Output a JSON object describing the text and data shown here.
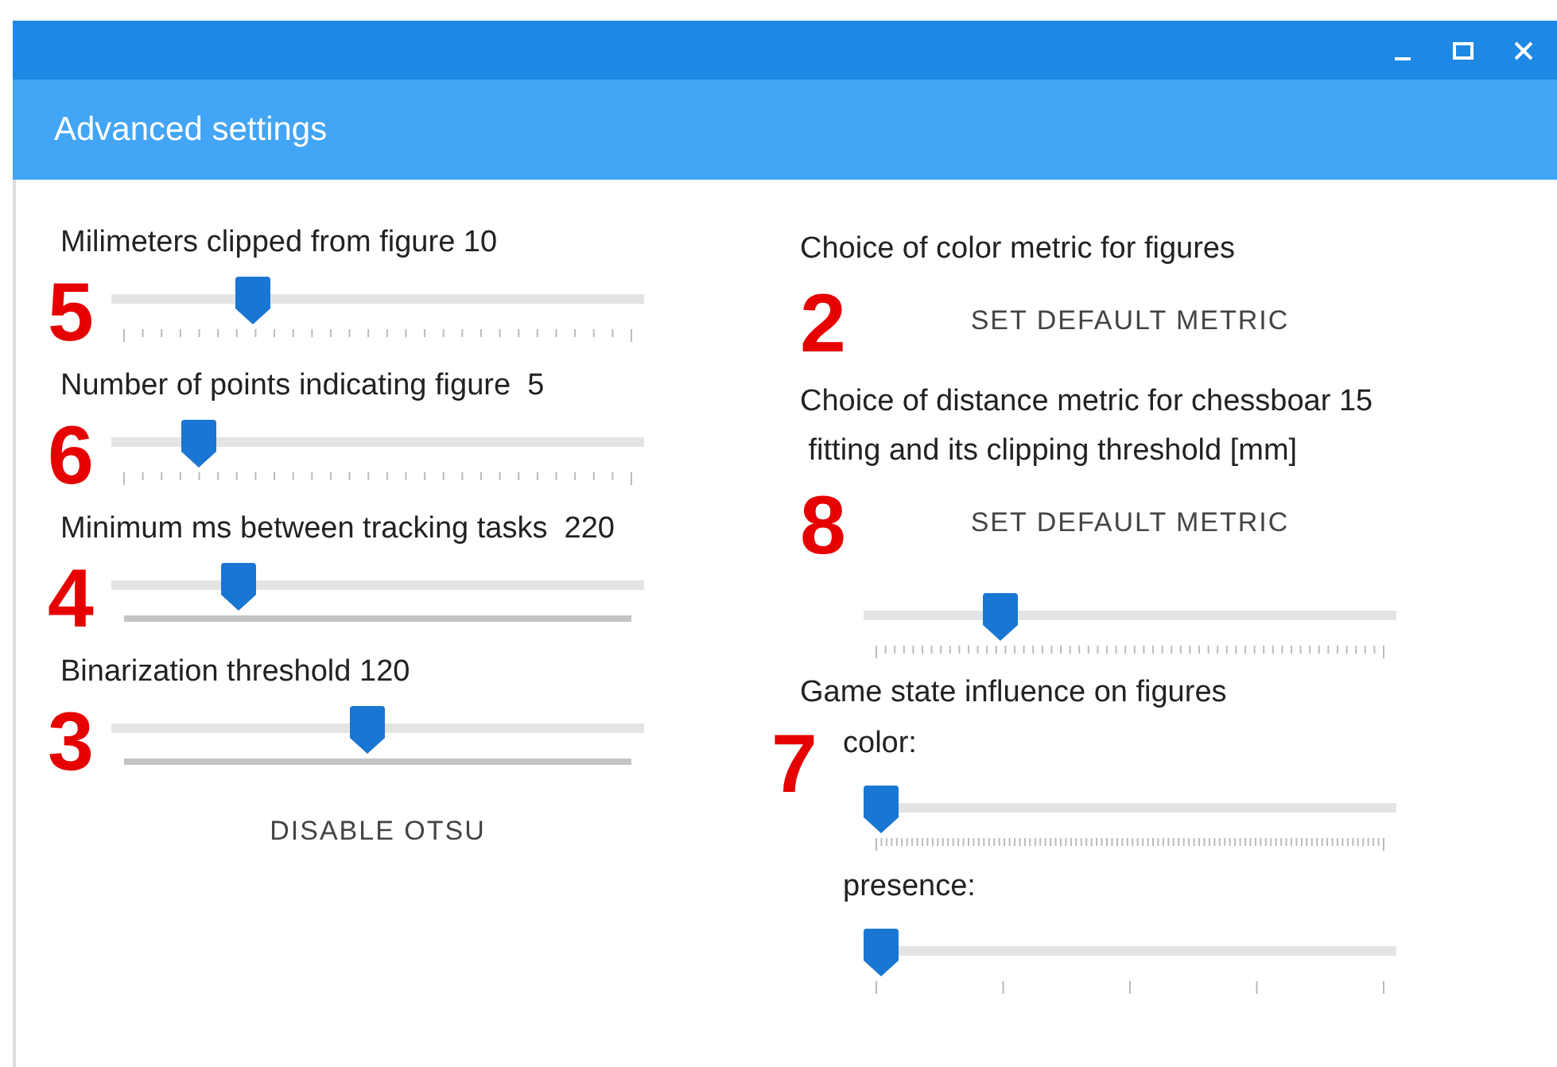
{
  "window": {
    "title": "Advanced settings"
  },
  "left": {
    "items": [
      {
        "kind": "slider",
        "label": "Milimeters clipped from figure 10",
        "annotation": "5",
        "level": 0.25,
        "scale": {
          "kind": "ticks"
        }
      },
      {
        "kind": "slider",
        "label": "Number of points indicating figure  5",
        "annotation": "6",
        "level": 0.14,
        "scale": {
          "kind": "ticks"
        }
      },
      {
        "kind": "slider",
        "label": "Minimum ms between tracking tasks  220",
        "annotation": "4",
        "level": 0.22,
        "scale": {
          "kind": "bar"
        }
      },
      {
        "kind": "slider",
        "label": "Binarization threshold 120",
        "annotation": "3",
        "level": 0.48,
        "scale": {
          "kind": "bar"
        }
      },
      {
        "kind": "button",
        "label": "DISABLE OTSU"
      }
    ]
  },
  "right": {
    "items": [
      {
        "kind": "heading",
        "label": "Choice of color metric for figures"
      },
      {
        "kind": "button",
        "label": "SET DEFAULT METRIC",
        "annotation": "2"
      },
      {
        "kind": "heading",
        "label": "Choice of distance metric for chessboar 15\n fitting and its clipping threshold [mm]"
      },
      {
        "kind": "button",
        "label": "SET DEFAULT METRIC",
        "annotation": "8"
      },
      {
        "kind": "slider",
        "level": 0.24,
        "scale": {
          "kind": "fine"
        }
      },
      {
        "kind": "heading",
        "label": "Game state influence on figures"
      },
      {
        "kind": "sublabel",
        "label": "color:",
        "annotation": "7"
      },
      {
        "kind": "slider",
        "level": 0,
        "scale": {
          "kind": "finest"
        }
      },
      {
        "kind": "sublabel",
        "label": "presence:"
      },
      {
        "kind": "slider",
        "level": 0,
        "scale": {
          "kind": "sparse"
        }
      }
    ]
  }
}
